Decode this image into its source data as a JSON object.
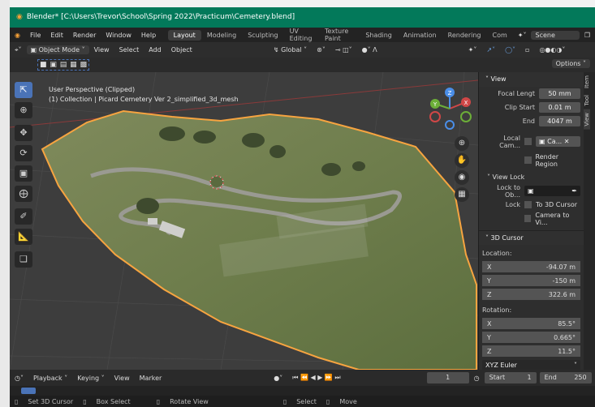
{
  "window": {
    "title": "Blender* [C:\\Users\\Trevor\\School\\Spring 2022\\Practicum\\Cemetery.blend]"
  },
  "menu": {
    "items": [
      "File",
      "Edit",
      "Render",
      "Window",
      "Help"
    ],
    "workspaces": [
      "Layout",
      "Modeling",
      "Sculpting",
      "UV Editing",
      "Texture Paint",
      "Shading",
      "Animation",
      "Rendering",
      "Com"
    ],
    "scene_label": "Scene"
  },
  "header": {
    "mode": "Object Mode",
    "menus": [
      "View",
      "Select",
      "Add",
      "Object"
    ],
    "orientation": "Global",
    "options": "Options"
  },
  "viewport": {
    "perspective": "User Perspective (Clipped)",
    "collection": "(1) Collection | Picard Cemetery Ver 2_simplified_3d_mesh",
    "gizmo_labels": {
      "x": "X",
      "y": "Y",
      "z": "Z"
    }
  },
  "npanel": {
    "view_header": "View",
    "focal_length_label": "Focal Lengt",
    "focal_length_value": "50 mm",
    "clip_start_label": "Clip Start",
    "clip_start_value": "0.01 m",
    "clip_end_label": "End",
    "clip_end_value": "4047 m",
    "local_camera_label": "Local Cam...",
    "local_camera_value": "Ca...",
    "render_region_label": "Render Region",
    "view_lock_header": "View Lock",
    "lock_to_object_label": "Lock to Ob...",
    "lock_label": "Lock",
    "to_3d_cursor_label": "To 3D Cursor",
    "camera_to_view_label": "Camera to Vi...",
    "cursor_header": "3D Cursor",
    "location_label": "Location:",
    "location": [
      {
        "axis": "X",
        "value": "-94.07 m"
      },
      {
        "axis": "Y",
        "value": "-150 m"
      },
      {
        "axis": "Z",
        "value": "322.6 m"
      }
    ],
    "rotation_label": "Rotation:",
    "rotation": [
      {
        "axis": "X",
        "value": "85.5°"
      },
      {
        "axis": "Y",
        "value": "0.665°"
      },
      {
        "axis": "Z",
        "value": "11.5°"
      }
    ],
    "rotation_mode": "XYZ Euler"
  },
  "side_tabs": [
    "Item",
    "Tool",
    "View"
  ],
  "timeline": {
    "playback": "Playback",
    "keying": "Keying",
    "view": "View",
    "marker": "Marker",
    "current_frame": "1",
    "start_label": "Start",
    "start_value": "1",
    "end_label": "End",
    "end_value": "250"
  },
  "status": {
    "items": [
      "Set 3D Cursor",
      "Box Select",
      "Rotate View",
      "Select",
      "Move"
    ]
  },
  "colors": {
    "title_bar": "#03795a",
    "accent_blue": "#4a73b7",
    "selection_outline": "#f7a440"
  }
}
